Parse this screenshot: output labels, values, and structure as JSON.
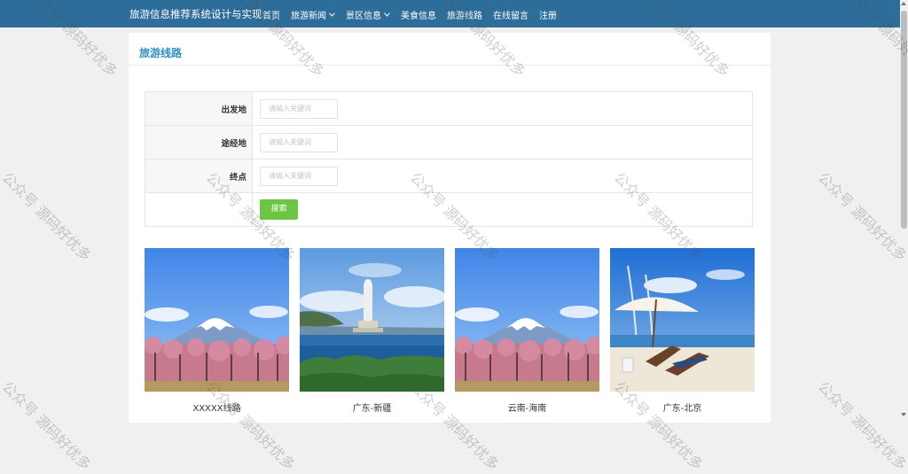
{
  "header": {
    "brand": "旅游信息推荐系统设计与实现",
    "nav": [
      {
        "label": "首页",
        "dropdown": false
      },
      {
        "label": "旅游新闻",
        "dropdown": true
      },
      {
        "label": "景区信息",
        "dropdown": true
      },
      {
        "label": "美食信息",
        "dropdown": false
      },
      {
        "label": "旅游线路",
        "dropdown": false
      },
      {
        "label": "在线留言",
        "dropdown": false
      },
      {
        "label": "注册",
        "dropdown": false
      }
    ]
  },
  "page": {
    "title": "旅游线路"
  },
  "search": {
    "fields": [
      {
        "label": "出发地",
        "placeholder": "请输入关键词",
        "value": ""
      },
      {
        "label": "途经地",
        "placeholder": "请输入关键词",
        "value": ""
      },
      {
        "label": "终点",
        "placeholder": "请输入关键词",
        "value": ""
      }
    ],
    "button_label": "搜索"
  },
  "routes": [
    {
      "title": "XXXXX线路",
      "image": "mount-fuji-cherry-blossom"
    },
    {
      "title": "广东-新疆",
      "image": "guanyin-statue-sea"
    },
    {
      "title": "云南-海南",
      "image": "mount-fuji-cherry-blossom"
    },
    {
      "title": "广东-北京",
      "image": "beach-umbrella-loungers"
    }
  ],
  "watermark": "公众号 源码好优多",
  "colors": {
    "topbar": "#2d6d9a",
    "title": "#2f8fc0",
    "search_button": "#6cc644"
  }
}
